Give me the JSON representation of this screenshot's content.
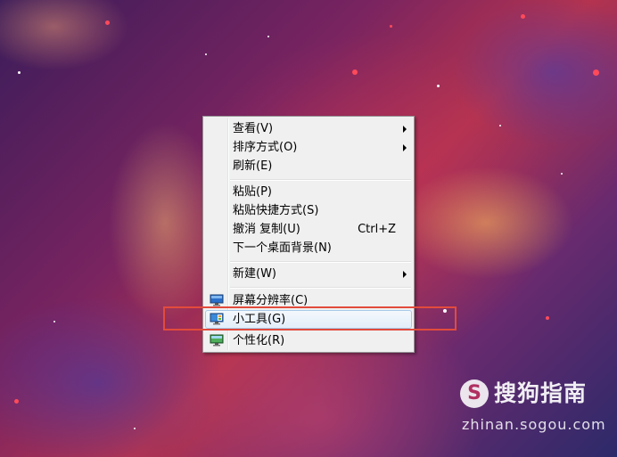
{
  "menu": {
    "items": [
      {
        "label": "查看(V)",
        "shortcut": "",
        "submenu": true
      },
      {
        "label": "排序方式(O)",
        "shortcut": "",
        "submenu": true
      },
      {
        "label": "刷新(E)",
        "shortcut": "",
        "submenu": false
      },
      {
        "label": "粘贴(P)",
        "shortcut": "",
        "submenu": false
      },
      {
        "label": "粘贴快捷方式(S)",
        "shortcut": "",
        "submenu": false
      },
      {
        "label": "撤消 复制(U)",
        "shortcut": "Ctrl+Z",
        "submenu": false
      },
      {
        "label": "下一个桌面背景(N)",
        "shortcut": "",
        "submenu": false
      },
      {
        "label": "新建(W)",
        "shortcut": "",
        "submenu": true
      },
      {
        "label": "屏幕分辨率(C)",
        "shortcut": "",
        "submenu": false,
        "icon": "display-icon"
      },
      {
        "label": "小工具(G)",
        "shortcut": "",
        "submenu": false,
        "icon": "gadgets-icon",
        "highlighted": true
      },
      {
        "label": "个性化(R)",
        "shortcut": "",
        "submenu": false,
        "icon": "personalize-icon"
      }
    ]
  },
  "watermark": {
    "logo_letter": "S",
    "title": "搜狗指南",
    "url": "zhinan.sogou.com"
  },
  "colors": {
    "highlight_border": "#e24b3c",
    "menu_bg": "#f0f0f0",
    "hover_border": "#a8c8e8"
  }
}
